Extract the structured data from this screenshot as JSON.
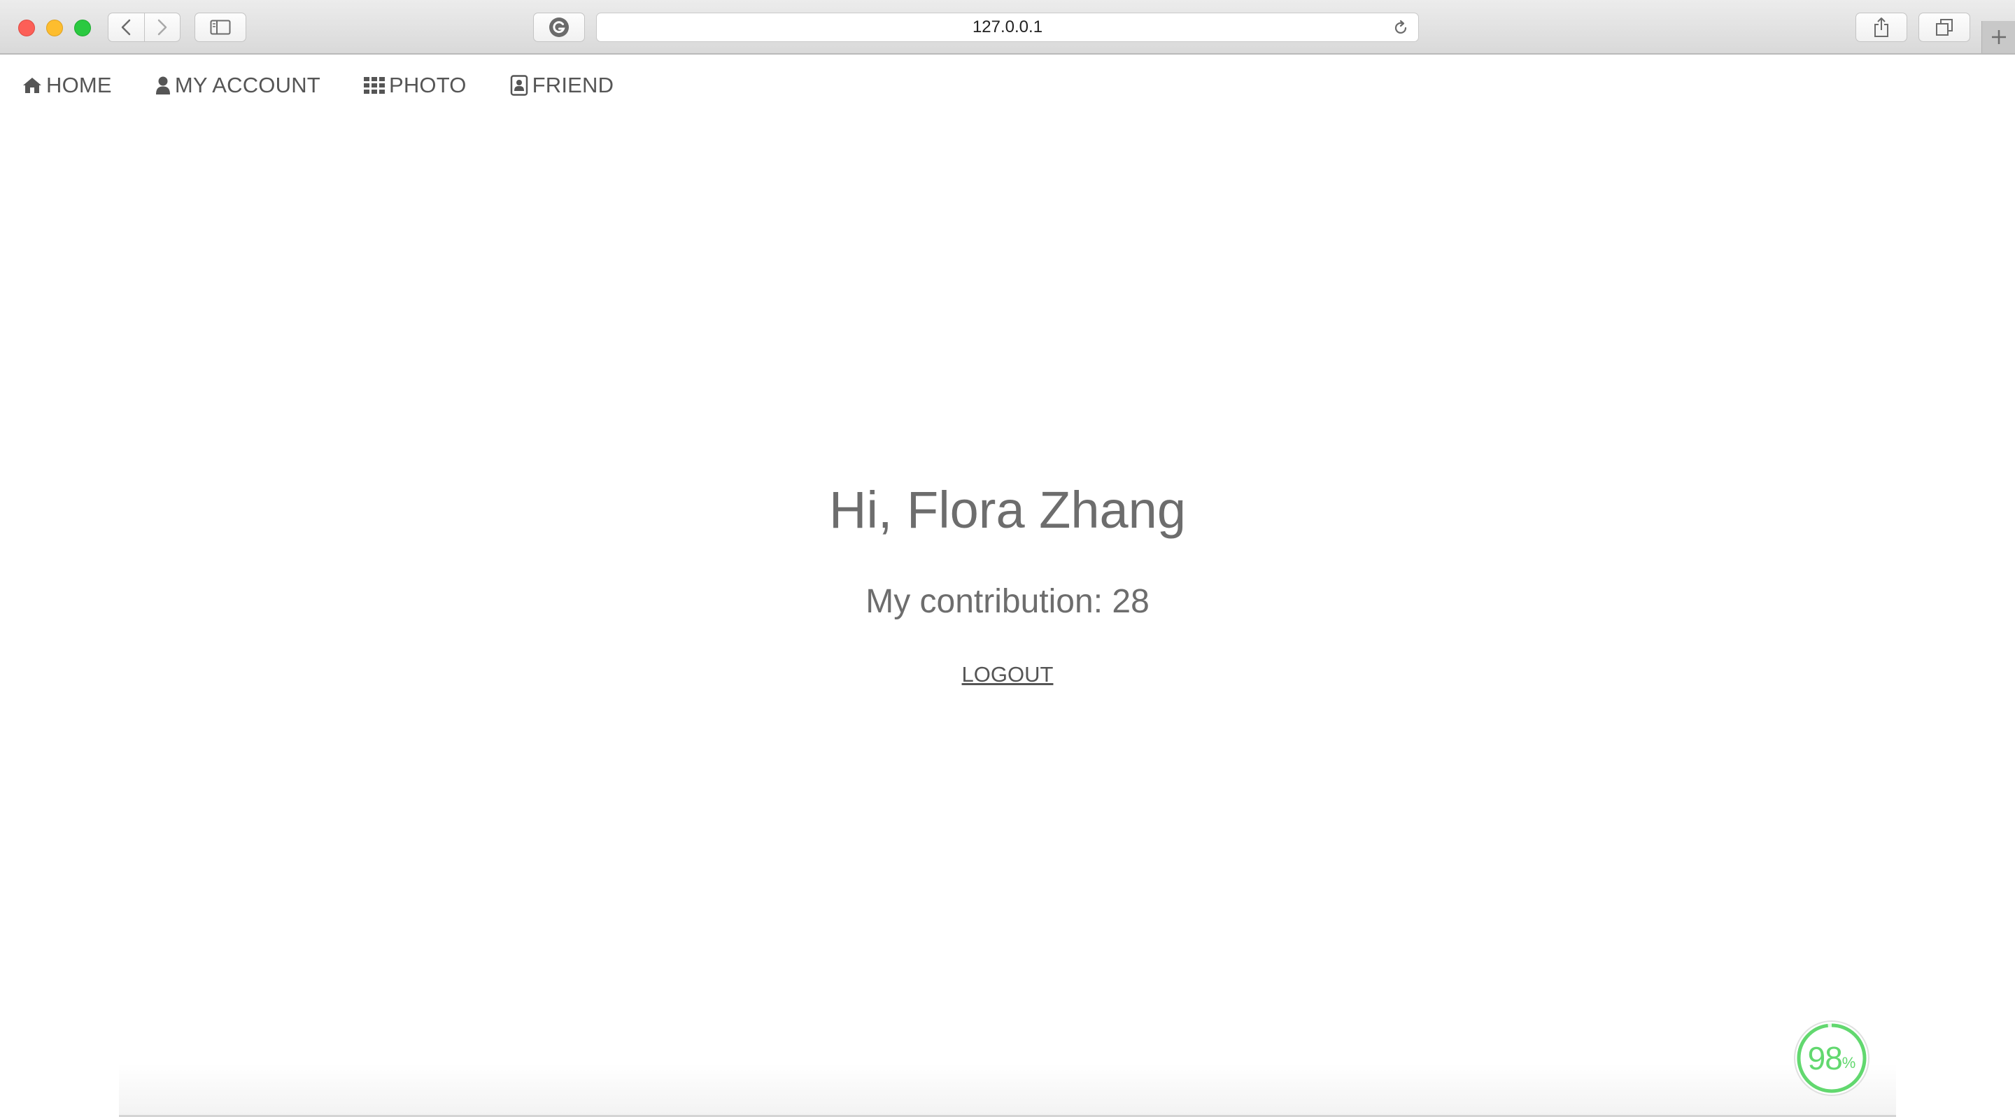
{
  "browser": {
    "url": "127.0.0.1",
    "icons": {
      "back": "chevron-left-icon",
      "forward": "chevron-right-icon",
      "sidebar": "sidebar-icon",
      "grammarly": "grammarly-icon",
      "reload": "reload-icon",
      "share": "share-icon",
      "tabs": "tabs-icon",
      "new_tab": "plus-icon"
    },
    "new_tab_label": "+"
  },
  "nav": {
    "items": [
      {
        "label": "HOME",
        "icon": "home-icon"
      },
      {
        "label": "MY ACCOUNT",
        "icon": "user-icon"
      },
      {
        "label": "PHOTO",
        "icon": "grid-icon"
      },
      {
        "label": "FRIEND",
        "icon": "contact-icon"
      }
    ]
  },
  "main": {
    "greeting": "Hi, Flora Zhang",
    "contribution_label": "My contribution:",
    "contribution_value": "28",
    "logout_label": "LOGOUT"
  },
  "score_badge": {
    "value": "98",
    "unit": "%",
    "fraction": 0.98
  },
  "colors": {
    "text": "#6d6d6d",
    "nav_text": "#555555",
    "score_green": "#62d86f"
  }
}
